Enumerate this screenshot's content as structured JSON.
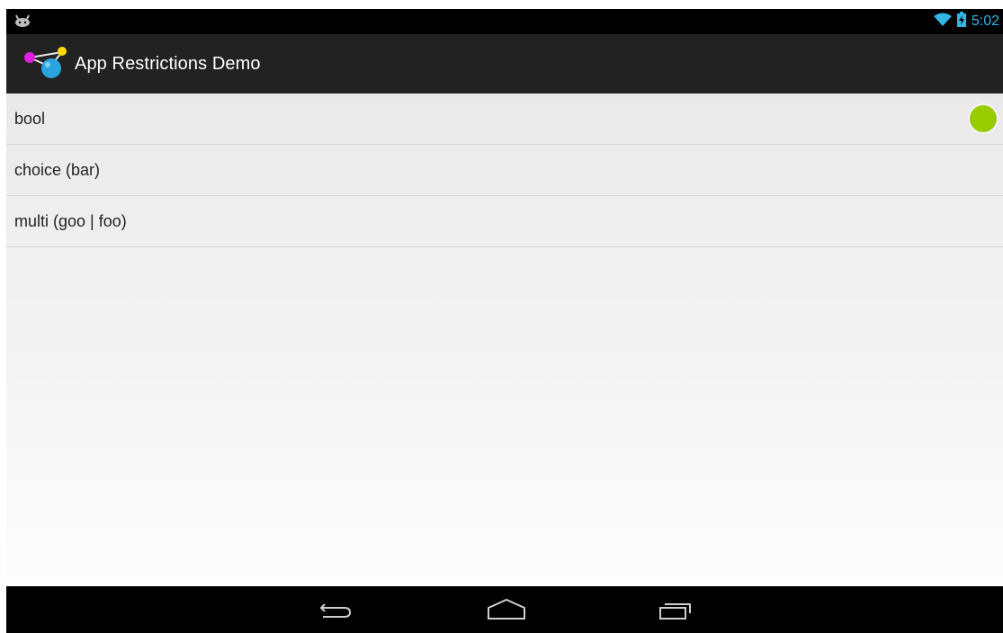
{
  "status_bar": {
    "notification_icon": "android-notification-icon",
    "wifi_icon": "wifi-icon",
    "battery_icon": "battery-charging-icon",
    "clock": "5:02",
    "accent_color": "#33b5e5"
  },
  "action_bar": {
    "app_icon": "app-restrictions-logo-icon",
    "title": "App Restrictions Demo"
  },
  "list": {
    "items": [
      {
        "label": "bool",
        "toggle": true,
        "toggle_color": "#99cc00"
      },
      {
        "label": "choice (bar)"
      },
      {
        "label": "multi (goo | foo)"
      }
    ]
  },
  "nav_bar": {
    "back_icon": "back-icon",
    "home_icon": "home-icon",
    "recents_icon": "recent-apps-icon"
  }
}
